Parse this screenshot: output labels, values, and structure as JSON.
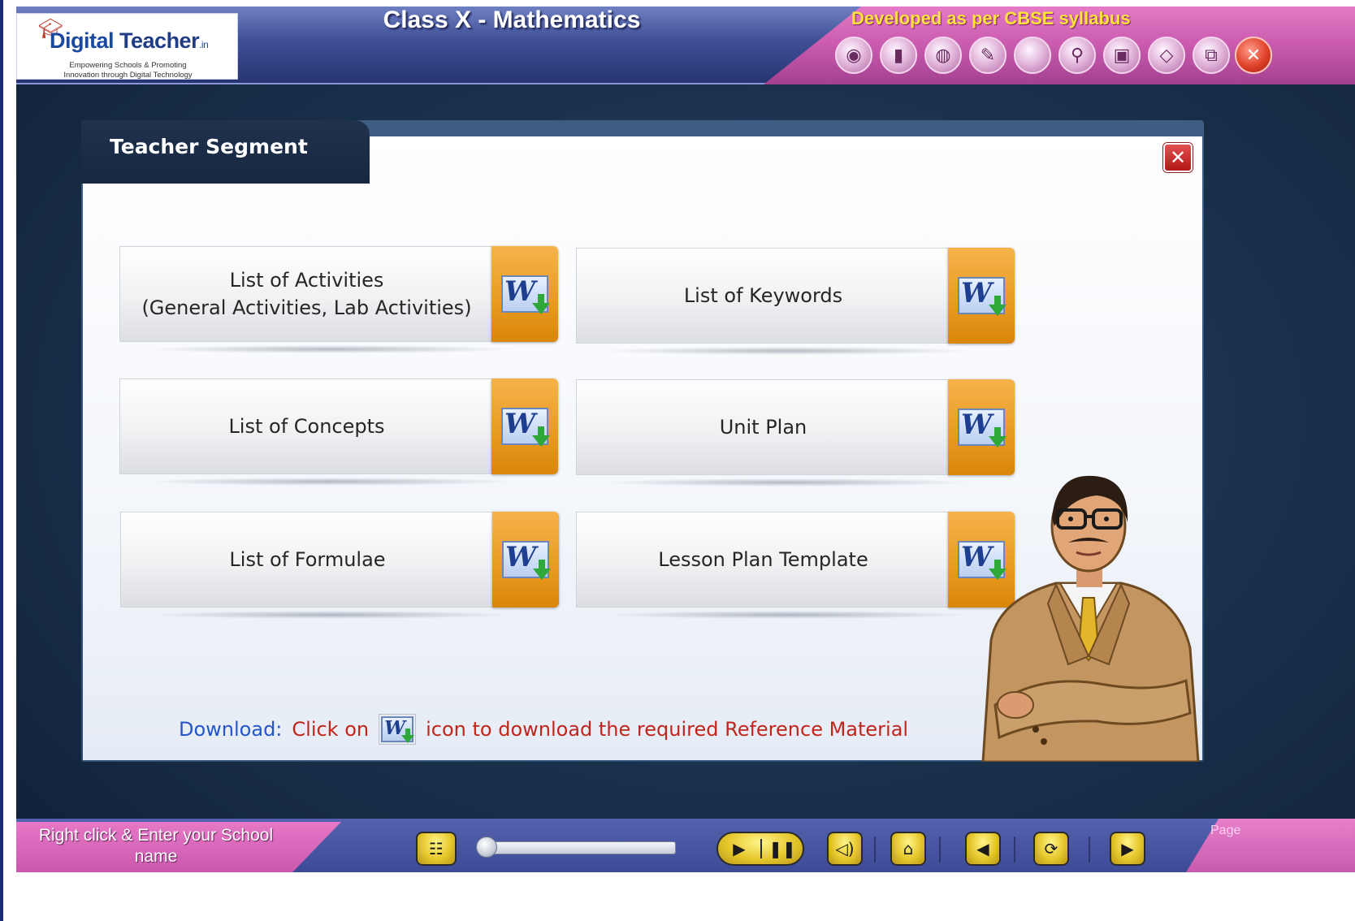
{
  "header": {
    "logo_brand_1": "Digital",
    "logo_brand_2": "Teacher",
    "logo_brand_3": ".in",
    "logo_tagline_1": "Empowering Schools & Promoting",
    "logo_tagline_2": "Innovation through Digital Technology",
    "title": "Class X - Mathematics",
    "cbse_note": "Developed as per CBSE syllabus",
    "tool_icons": [
      "camera-icon",
      "book-icon",
      "disc-icon",
      "notepad-icon",
      "blank-icon",
      "search-icon",
      "dictionary-icon",
      "eraser-icon",
      "window-icon",
      "close-icon"
    ]
  },
  "panel": {
    "title": "Teacher Segment",
    "close_symbol": "✕",
    "resources": [
      {
        "line1": "List of Activities",
        "line2": "(General Activities, Lab Activities)"
      },
      {
        "line1": "List of Keywords",
        "line2": ""
      },
      {
        "line1": "List of Concepts",
        "line2": ""
      },
      {
        "line1": "Unit Plan",
        "line2": ""
      },
      {
        "line1": "List of Formulae",
        "line2": ""
      },
      {
        "line1": "Lesson Plan Template",
        "line2": ""
      }
    ],
    "download_icon_letter": "W",
    "download_note": {
      "label": "Download:",
      "before_icon": "Click on",
      "after_icon": "icon to download the required Reference Material"
    }
  },
  "bottom_bar": {
    "school_prompt": "Right click & Enter your School name",
    "page_label": "Page",
    "controls": [
      "tree-icon",
      "play-icon",
      "pause-icon",
      "volume-icon",
      "home-icon",
      "previous-icon",
      "refresh-icon",
      "next-icon"
    ]
  },
  "colors": {
    "header_blue": "#3f4f96",
    "header_pink": "#c95aae",
    "cbse_yellow": "#ffe23a",
    "download_orange": "#e79a1f",
    "note_blue": "#2456c8",
    "note_red": "#c0261c",
    "close_red": "#b41717"
  }
}
